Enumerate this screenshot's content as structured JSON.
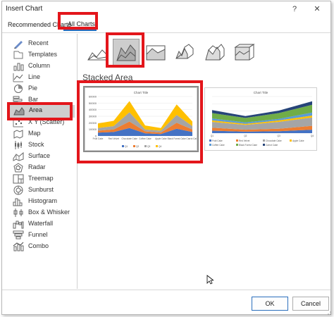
{
  "window": {
    "title": "Insert Chart",
    "help_glyph": "?",
    "close_glyph": "✕"
  },
  "tabs": [
    {
      "label": "Recommended Charts",
      "active": false
    },
    {
      "label": "All Charts",
      "active": true
    }
  ],
  "sidebar": {
    "items": [
      {
        "label": "Recent",
        "icon": "recent-icon"
      },
      {
        "label": "Templates",
        "icon": "templates-icon"
      },
      {
        "label": "Column",
        "icon": "column-chart-icon"
      },
      {
        "label": "Line",
        "icon": "line-chart-icon"
      },
      {
        "label": "Pie",
        "icon": "pie-chart-icon"
      },
      {
        "label": "Bar",
        "icon": "bar-chart-icon"
      },
      {
        "label": "Area",
        "icon": "area-chart-icon",
        "selected": true
      },
      {
        "label": "X Y (Scatter)",
        "icon": "scatter-chart-icon"
      },
      {
        "label": "Map",
        "icon": "map-chart-icon"
      },
      {
        "label": "Stock",
        "icon": "stock-chart-icon"
      },
      {
        "label": "Surface",
        "icon": "surface-chart-icon"
      },
      {
        "label": "Radar",
        "icon": "radar-chart-icon"
      },
      {
        "label": "Treemap",
        "icon": "treemap-chart-icon"
      },
      {
        "label": "Sunburst",
        "icon": "sunburst-chart-icon"
      },
      {
        "label": "Histogram",
        "icon": "histogram-chart-icon"
      },
      {
        "label": "Box & Whisker",
        "icon": "box-whisker-chart-icon"
      },
      {
        "label": "Waterfall",
        "icon": "waterfall-chart-icon"
      },
      {
        "label": "Funnel",
        "icon": "funnel-chart-icon"
      },
      {
        "label": "Combo",
        "icon": "combo-chart-icon"
      }
    ]
  },
  "subtypes": [
    {
      "icon": "area-subtype-icon",
      "selected": false
    },
    {
      "icon": "stacked-area-subtype-icon",
      "selected": true
    },
    {
      "icon": "100-stacked-area-subtype-icon",
      "selected": false
    },
    {
      "icon": "3d-area-subtype-icon",
      "selected": false
    },
    {
      "icon": "3d-stacked-area-subtype-icon",
      "selected": false
    },
    {
      "icon": "3d-100-stacked-area-subtype-icon",
      "selected": false
    }
  ],
  "section_heading": "Stacked Area",
  "colors": {
    "highlight": "#e3161b",
    "accent": "#2b6fbd",
    "selected_bg": "#cdcdcd",
    "series_q1": "#4472c4",
    "series_q2": "#ed7d31",
    "series_q3": "#a5a5a5",
    "series_q4": "#ffc000"
  },
  "chart_data": [
    {
      "type": "area",
      "stacked": true,
      "title": "Chart Title",
      "categories": [
        "Fruit Cake",
        "Red Velvet",
        "Chocolate Cake",
        "Coffee Cake",
        "Apple Cake",
        "Black Forest Cake",
        "Carrot Cake"
      ],
      "series": [
        {
          "name": "Q1",
          "values": [
            5000,
            6000,
            12000,
            4000,
            3000,
            11000,
            6000
          ]
        },
        {
          "name": "Q2",
          "values": [
            3000,
            4000,
            10000,
            3000,
            2000,
            9000,
            4000
          ]
        },
        {
          "name": "Q3",
          "values": [
            4000,
            5000,
            14000,
            3000,
            3000,
            12000,
            5000
          ]
        },
        {
          "name": "Q4",
          "values": [
            7000,
            8000,
            17000,
            6000,
            4000,
            16000,
            7000
          ]
        }
      ],
      "y_ticks": [
        "0",
        "10000",
        "20000",
        "30000",
        "40000",
        "50000",
        "60000"
      ],
      "ylim": [
        0,
        60000
      ],
      "legend": "bottom"
    },
    {
      "type": "area",
      "stacked": true,
      "title": "Chart Title",
      "categories": [
        "Q1",
        "Q2",
        "Q3",
        "Q4"
      ],
      "series": [
        {
          "name": "Fruit Cake",
          "values": [
            5000,
            3000,
            4000,
            7000
          ]
        },
        {
          "name": "Red Velvet",
          "values": [
            6000,
            4000,
            5000,
            8000
          ]
        },
        {
          "name": "Chocolate Cake",
          "values": [
            12000,
            10000,
            14000,
            17000
          ]
        },
        {
          "name": "Apple Cake",
          "values": [
            3000,
            2000,
            3000,
            4000
          ]
        },
        {
          "name": "Coffee Cake",
          "values": [
            4000,
            3000,
            3000,
            6000
          ]
        },
        {
          "name": "Black Forest Cake",
          "values": [
            11000,
            9000,
            12000,
            16000
          ]
        },
        {
          "name": "Carrot Cake",
          "values": [
            6000,
            4000,
            5000,
            7000
          ]
        }
      ],
      "legend": "bottom"
    }
  ],
  "footer": {
    "ok_label": "OK",
    "cancel_label": "Cancel"
  }
}
